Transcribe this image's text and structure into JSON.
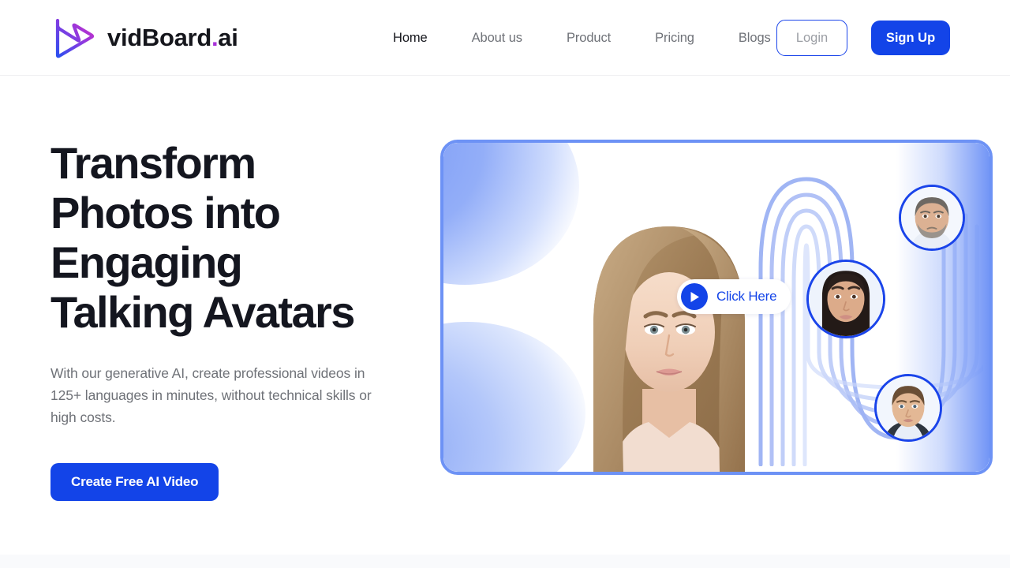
{
  "brand": {
    "name_main": "vidBoard",
    "name_dot": ".",
    "name_suffix": "ai",
    "logo_icon": "vidboard-play-logo"
  },
  "nav": {
    "items": [
      {
        "label": "Home",
        "active": true
      },
      {
        "label": "About us",
        "active": false
      },
      {
        "label": "Product",
        "active": false
      },
      {
        "label": "Pricing",
        "active": false
      },
      {
        "label": "Blogs",
        "active": false
      }
    ]
  },
  "auth": {
    "login_label": "Login",
    "signup_label": "Sign Up"
  },
  "hero": {
    "title_line1": "Transform",
    "title_line2": "Photos into",
    "title_line3": "Engaging",
    "title_line4": "Talking Avatars",
    "subtitle": "With our generative AI, create professional videos in 125+ languages in minutes, without technical skills or high costs.",
    "cta_label": "Create Free AI Video"
  },
  "media": {
    "click_label": "Click Here",
    "play_icon": "play-icon",
    "main_portrait": "woman-portrait",
    "avatars": [
      {
        "name": "avatar-man-grey-beard"
      },
      {
        "name": "avatar-woman-dark-hair"
      },
      {
        "name": "avatar-man-short-hair"
      }
    ]
  },
  "colors": {
    "accent_blue": "#1344e8",
    "panel_border": "#6d92f5",
    "wave_blue": "#8fa8f2",
    "heading": "#14161f",
    "muted_text": "#6f7278",
    "logo_gradient_start": "#2b4ff0",
    "logo_gradient_end": "#d32bc4"
  }
}
